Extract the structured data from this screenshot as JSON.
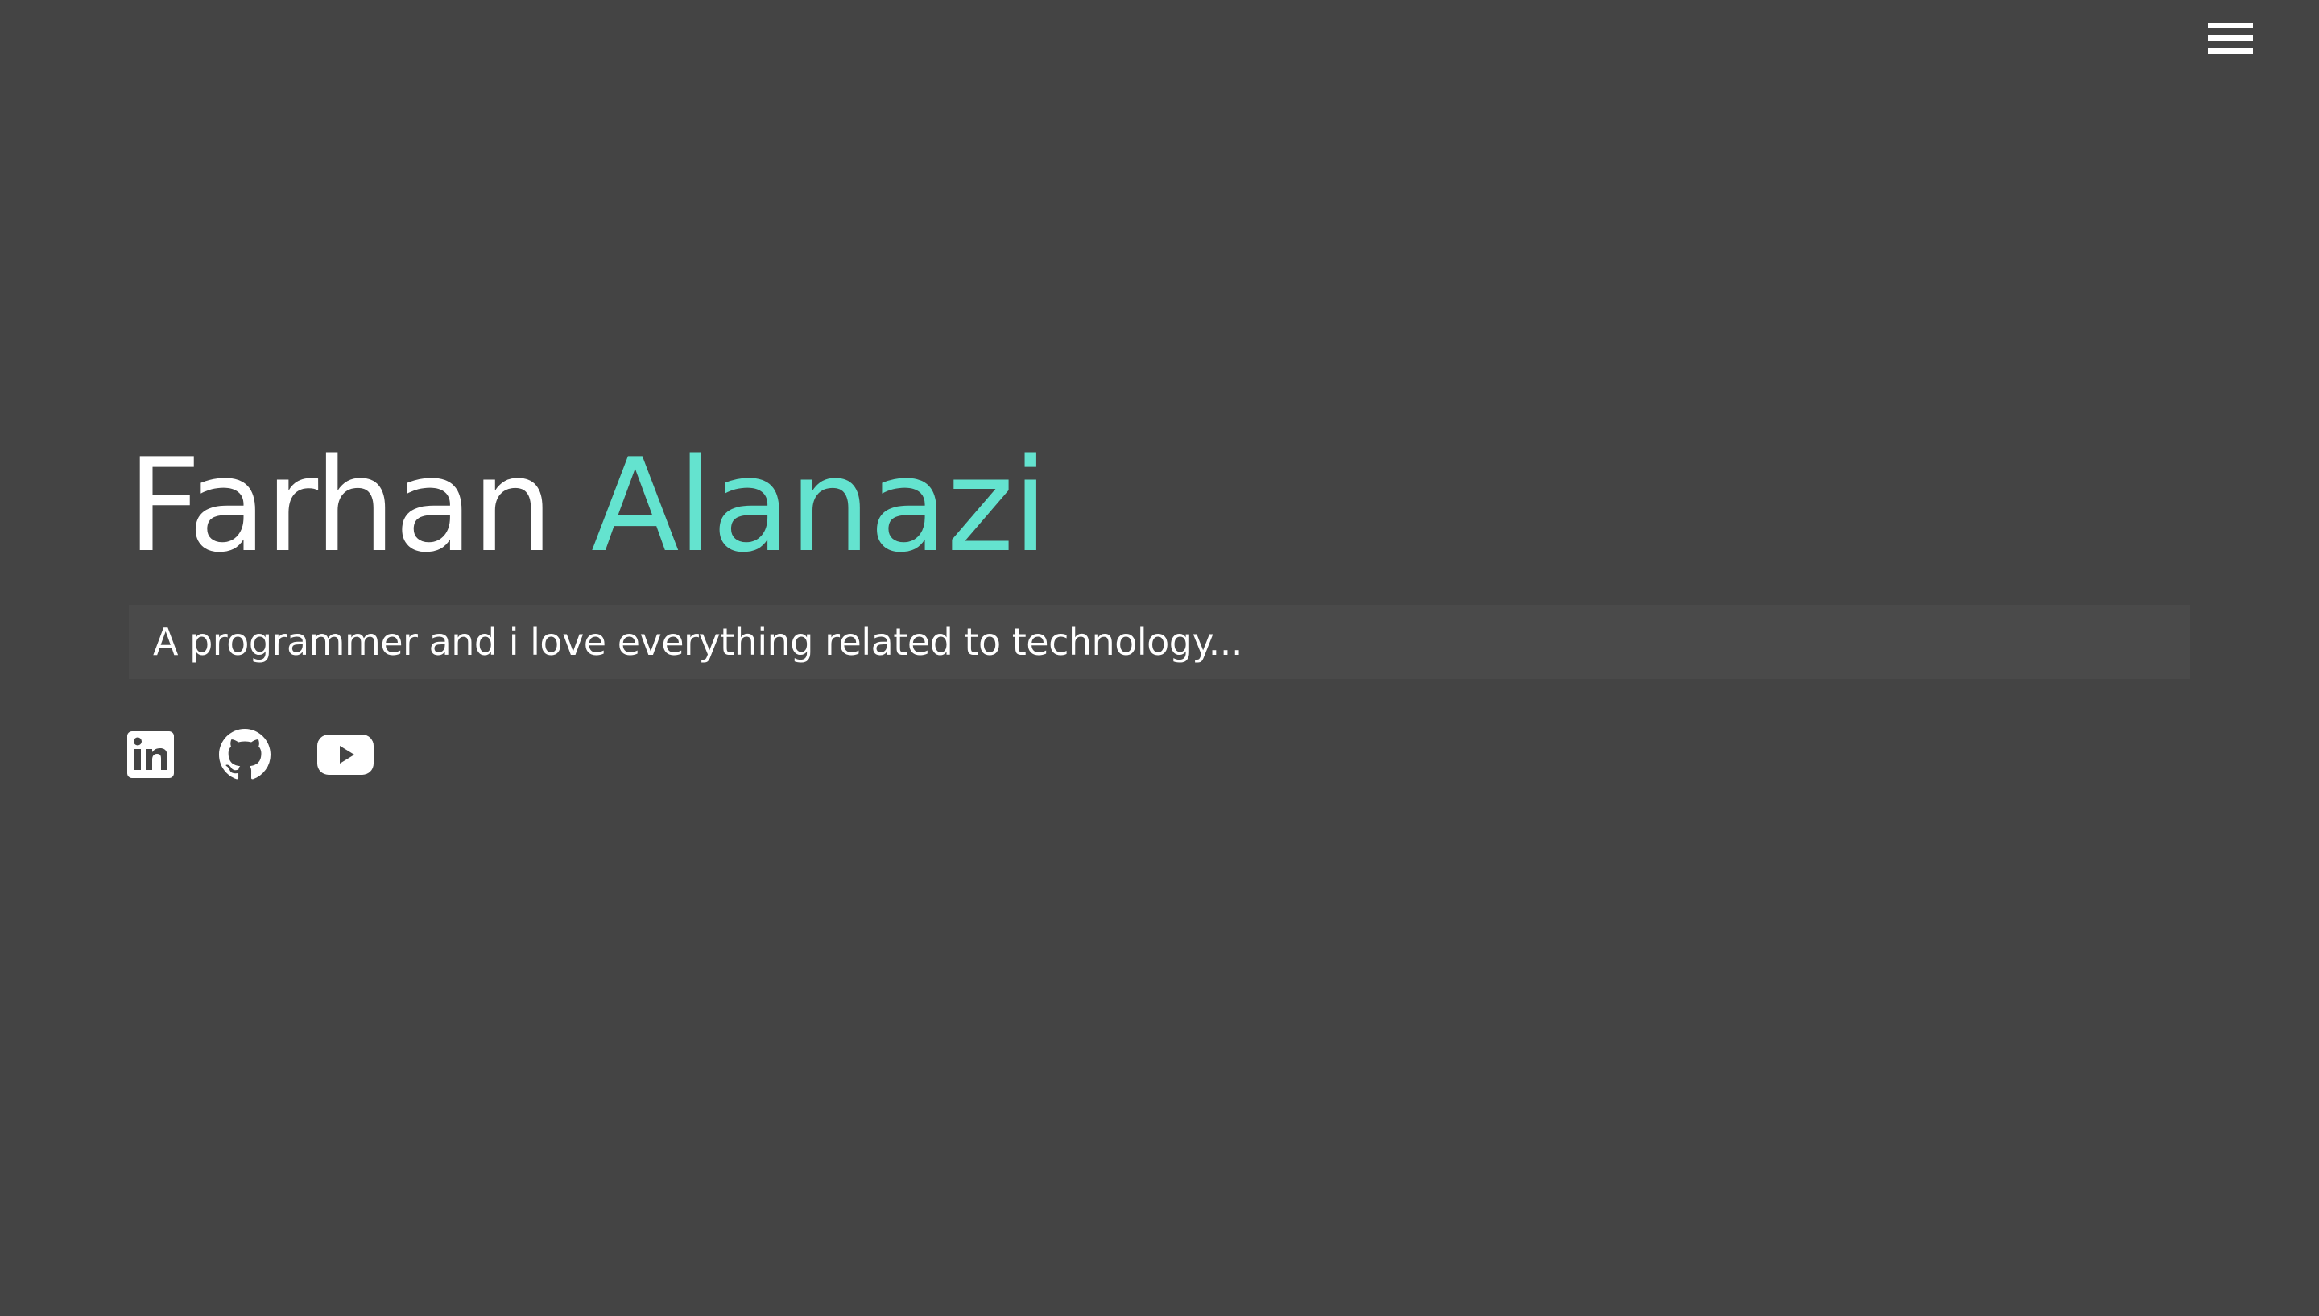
{
  "header": {
    "menu_icon": "hamburger-menu-icon"
  },
  "hero": {
    "first_name": "Farhan",
    "last_name": "Alanazi",
    "tagline": "A programmer and i love everything related to technology..."
  },
  "social_links": [
    {
      "icon": "linkedin-icon"
    },
    {
      "icon": "github-icon"
    },
    {
      "icon": "youtube-icon"
    }
  ],
  "colors": {
    "background": "#444444",
    "accent": "#64e3cf",
    "text": "#ffffff",
    "tagline_box": "#4a4a4a"
  }
}
